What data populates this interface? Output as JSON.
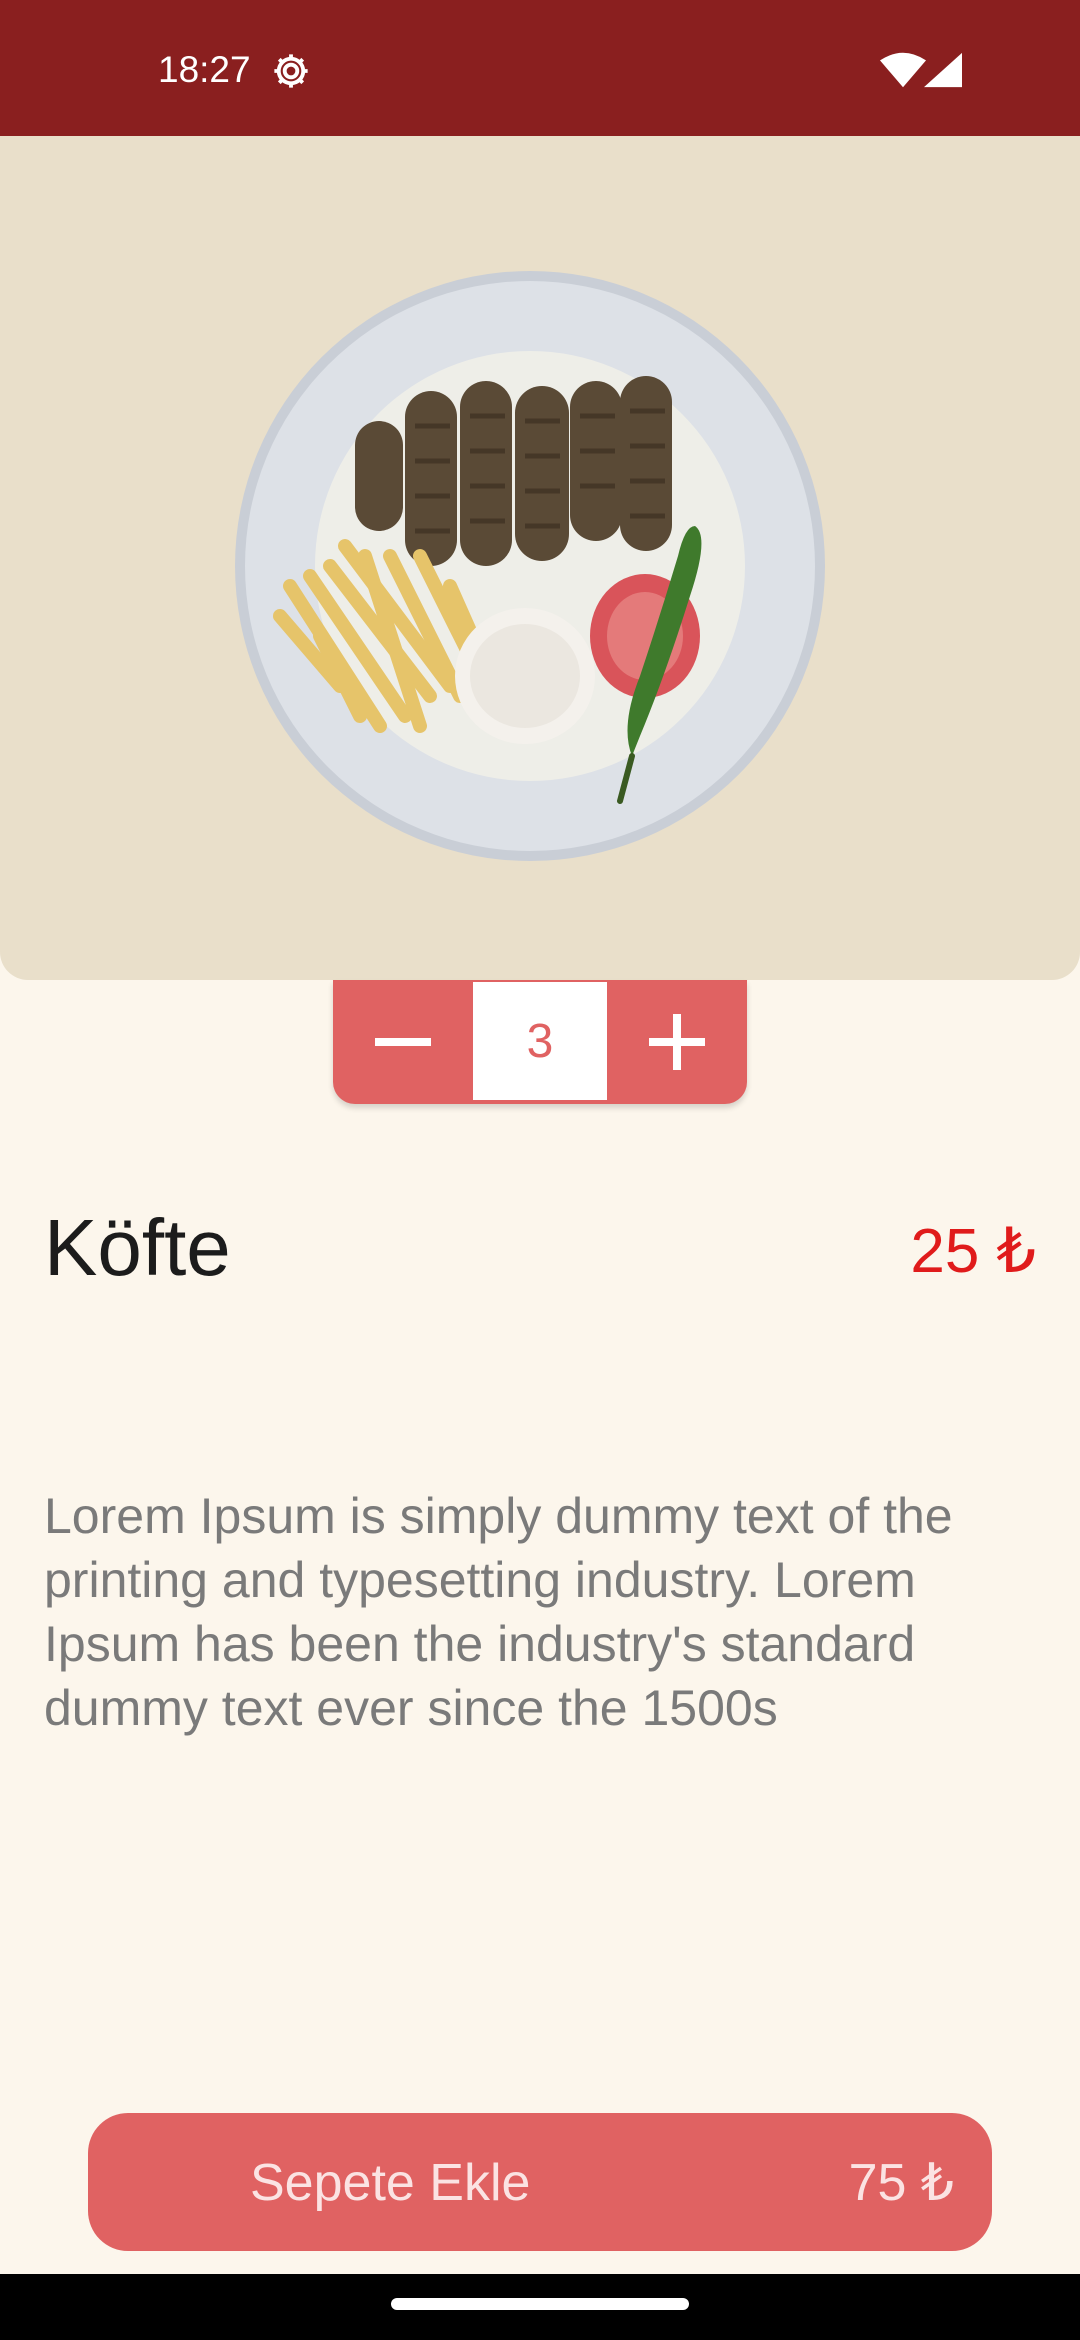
{
  "status_bar": {
    "time": "18:27"
  },
  "stepper": {
    "quantity": "3"
  },
  "product": {
    "title": "Köfte",
    "price": "25 ₺",
    "description": "Lorem Ipsum is simply dummy text of the printing and typesetting industry. Lorem Ipsum has been the industry's standard dummy text ever since the 1500s"
  },
  "cart_button": {
    "label": "Sepete Ekle",
    "total": "75 ₺"
  },
  "colors": {
    "status_bar": "#8a1f1f",
    "accent": "#e06262",
    "price": "#e01b1b",
    "background": "#fcf6ec",
    "hero_background": "#e9dfca"
  }
}
